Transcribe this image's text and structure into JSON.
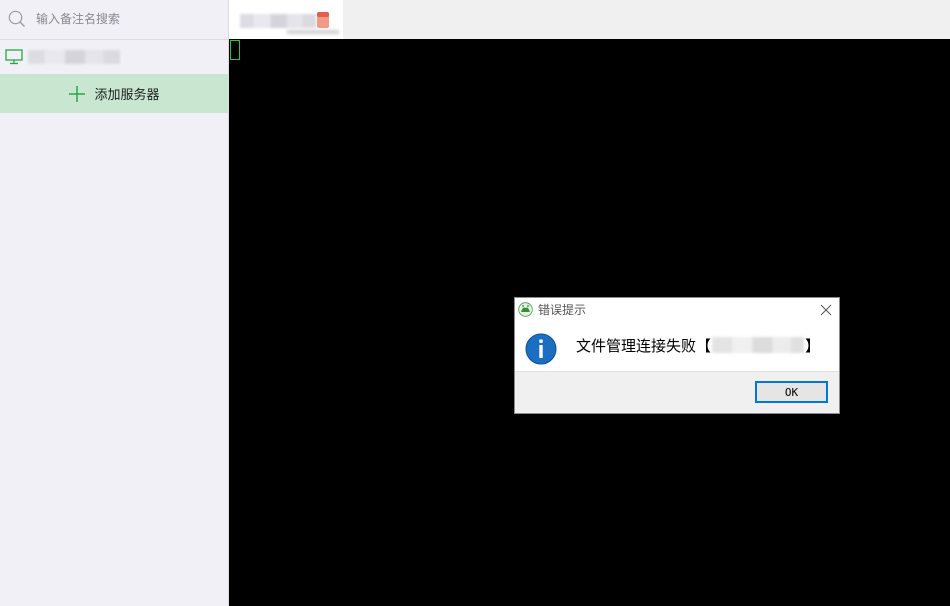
{
  "sidebar": {
    "search_placeholder": "输入备注名搜索",
    "add_server_label": "添加服务器"
  },
  "dialog": {
    "title": "错误提示",
    "message": "文件管理连接失败",
    "bracket_open": "【",
    "bracket_close": "】",
    "ok_label": "OK"
  },
  "icons": {
    "search": "search-icon",
    "server": "monitor-icon",
    "add": "plus-icon",
    "tab": "tab-icon",
    "dialog_app": "app-icon",
    "dialog_close": "close-icon",
    "dialog_info": "info-icon"
  },
  "colors": {
    "accent_green": "#2aa745",
    "add_button_bg": "#c8e6d0",
    "sidebar_bg": "#f0f0f6",
    "terminal_bg": "#000000",
    "cursor": "#22c83a",
    "info_blue": "#1b6ec2",
    "ok_border": "#0078d7"
  }
}
